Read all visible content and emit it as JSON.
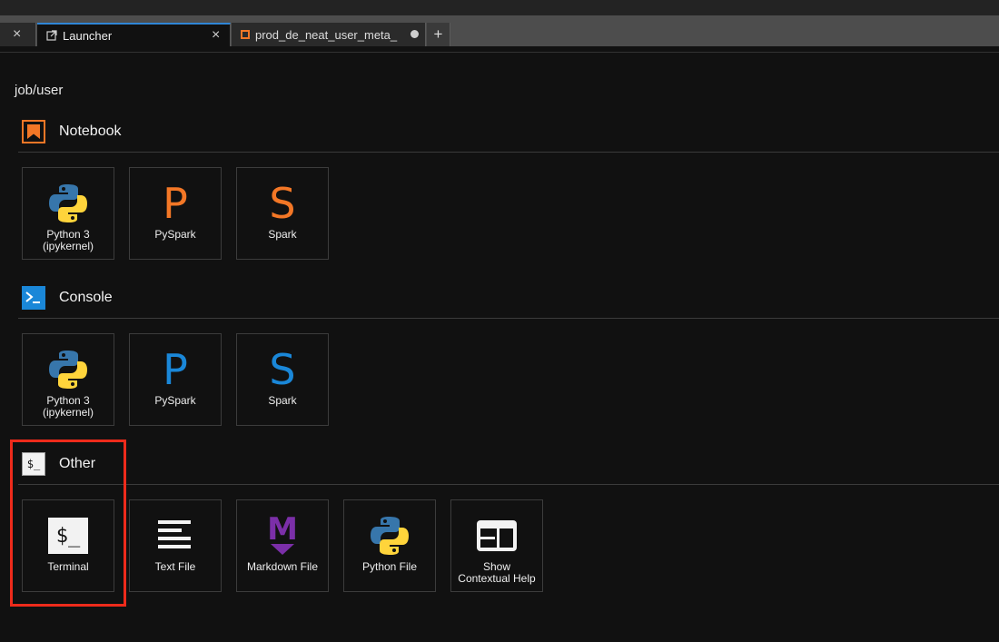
{
  "tabs": {
    "launcher_label": "Launcher",
    "notebook_label": "prod_de_neat_user_meta_",
    "add_label": "+",
    "close_glyph": "×"
  },
  "cwd": "job/user",
  "sections": {
    "notebook": {
      "title": "Notebook",
      "items": [
        {
          "label": "Python 3\n(ipykernel)",
          "icon": "python-logo-icon"
        },
        {
          "label": "PySpark",
          "icon": "pyspark-notebook-icon",
          "letter": "P"
        },
        {
          "label": "Spark",
          "icon": "spark-notebook-icon",
          "letter": "S"
        }
      ]
    },
    "console": {
      "title": "Console",
      "items": [
        {
          "label": "Python 3\n(ipykernel)",
          "icon": "python-logo-icon"
        },
        {
          "label": "PySpark",
          "icon": "pyspark-console-icon",
          "letter": "P"
        },
        {
          "label": "Spark",
          "icon": "spark-console-icon",
          "letter": "S"
        }
      ]
    },
    "other": {
      "title": "Other",
      "header_icon_text": "$_",
      "items": [
        {
          "label": "Terminal",
          "icon": "terminal-icon",
          "icon_text": "$_"
        },
        {
          "label": "Text File",
          "icon": "text-file-icon"
        },
        {
          "label": "Markdown File",
          "icon": "markdown-icon",
          "letter": "M"
        },
        {
          "label": "Python File",
          "icon": "python-logo-icon"
        },
        {
          "label": "Show\nContextual Help",
          "icon": "contextual-help-icon"
        }
      ]
    }
  },
  "colors": {
    "notebook_orange": "#f37726",
    "console_blue": "#1a87d8",
    "markdown_purple": "#7b2fa8",
    "highlight_red": "#ee2b1b",
    "python_blue": "#3776ab",
    "python_yellow": "#ffd43b"
  }
}
